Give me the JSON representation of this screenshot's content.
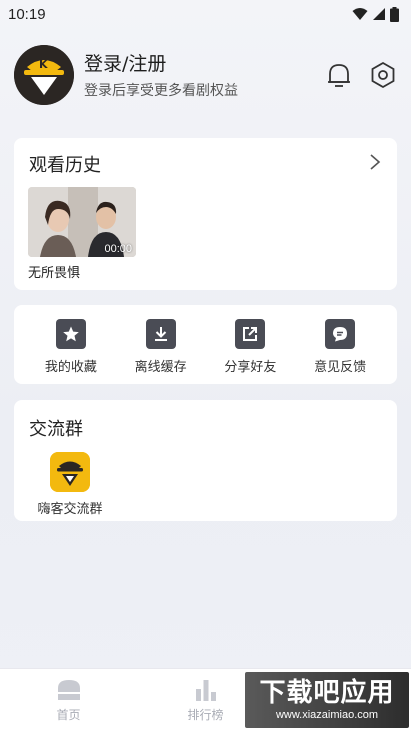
{
  "status_bar": {
    "time": "10:19"
  },
  "profile": {
    "title": "登录/注册",
    "subtitle": "登录后享受更多看剧权益"
  },
  "history": {
    "title": "观看历史",
    "items": [
      {
        "title": "无所畏惧",
        "duration": "00:00"
      }
    ]
  },
  "tools": [
    {
      "label": "我的收藏",
      "icon": "star-icon"
    },
    {
      "label": "离线缓存",
      "icon": "download-icon"
    },
    {
      "label": "分享好友",
      "icon": "share-icon"
    },
    {
      "label": "意见反馈",
      "icon": "feedback-icon"
    }
  ],
  "group": {
    "title": "交流群",
    "items": [
      {
        "label": "嗨客交流群"
      }
    ]
  },
  "bottom_nav": [
    {
      "label": "首页",
      "icon": "home-icon"
    },
    {
      "label": "排行榜",
      "icon": "ranking-icon"
    }
  ],
  "watermark": {
    "main": "下载吧应用",
    "url": "www.xiazaimiao.com"
  },
  "colors": {
    "avatar_bg": "#2b2623",
    "brand_yellow": "#f3b90f",
    "tool_icon_bg": "#4a4c55",
    "nav_inactive": "#a9acb5"
  }
}
